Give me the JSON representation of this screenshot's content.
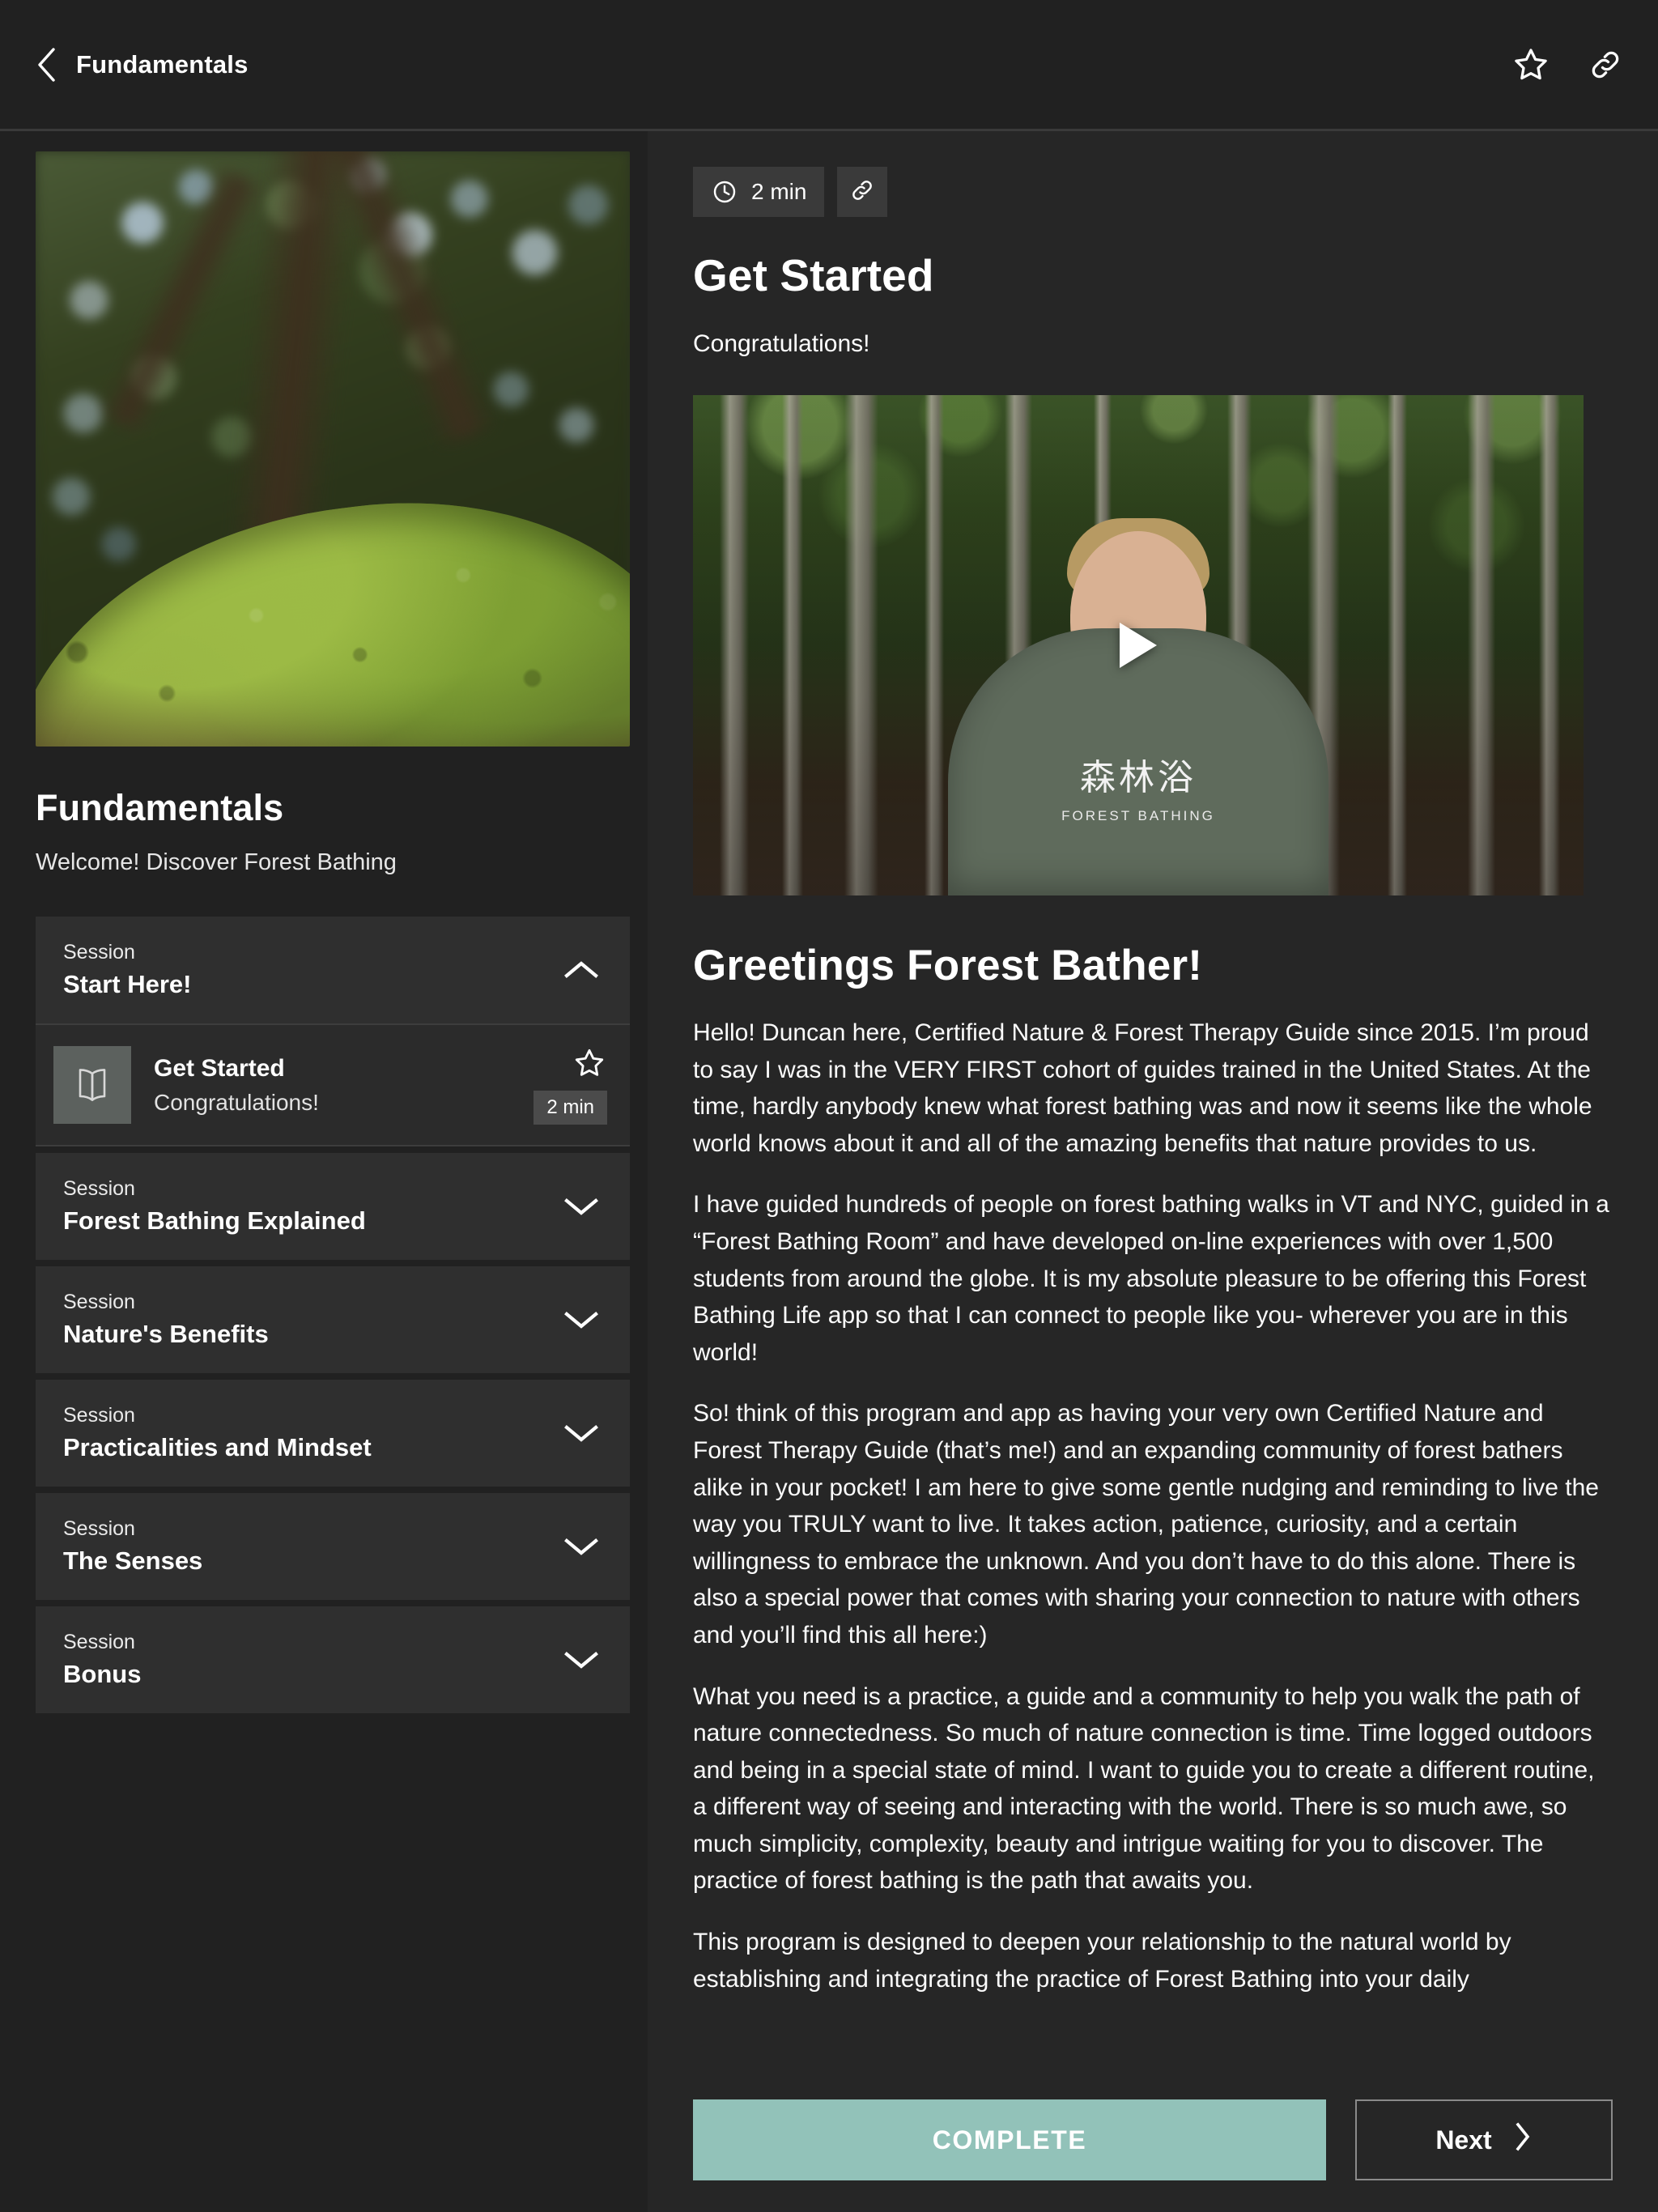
{
  "topbar": {
    "back_icon": "chevron-left-icon",
    "title": "Fundamentals",
    "favorite_icon": "star-outline-icon",
    "link_icon": "link-icon"
  },
  "sidebar": {
    "hero_image_alt": "mossy-tree-branch-photo",
    "course_title": "Fundamentals",
    "course_subtitle": "Welcome!  Discover Forest Bathing",
    "session_kicker": "Session",
    "sessions": [
      {
        "kicker": "Session",
        "name": "Start Here!",
        "expanded": true,
        "chevron": "chevron-up-icon"
      },
      {
        "kicker": "Session",
        "name": "Forest Bathing Explained",
        "expanded": false,
        "chevron": "chevron-down-icon"
      },
      {
        "kicker": "Session",
        "name": "Nature's Benefits",
        "expanded": false,
        "chevron": "chevron-down-icon"
      },
      {
        "kicker": "Session",
        "name": "Practicalities and Mindset",
        "expanded": false,
        "chevron": "chevron-down-icon"
      },
      {
        "kicker": "Session",
        "name": "The Senses",
        "expanded": false,
        "chevron": "chevron-down-icon"
      },
      {
        "kicker": "Session",
        "name": "Bonus",
        "expanded": false,
        "chevron": "chevron-down-icon"
      }
    ],
    "lesson": {
      "icon": "open-book-icon",
      "title": "Get Started",
      "subtitle": "Congratulations!",
      "duration": "2 min",
      "star_icon": "star-outline-icon"
    }
  },
  "main": {
    "duration_chip": {
      "icon": "clock-icon",
      "label": "2 min"
    },
    "link_chip_icon": "link-icon",
    "lesson_title": "Get Started",
    "lesson_tagline": "Congratulations!",
    "video": {
      "play_icon": "play-triangle-icon",
      "shirt_kanji": "森林浴",
      "shirt_subtext": "FOREST BATHING"
    },
    "article_heading": "Greetings Forest Bather!",
    "paragraphs": [
      "Hello! Duncan here, Certified Nature & Forest Therapy Guide since 2015. I’m proud to say I was in the VERY FIRST cohort of guides trained in the United States. At the time, hardly anybody knew what forest bathing was and now it seems like the whole world knows about it and all of the amazing benefits that nature provides to us.",
      "I have guided hundreds of people on forest bathing walks in VT and NYC, guided in a “Forest Bathing Room” and have developed on-line experiences with over 1,500 students from around the globe. It is my absolute pleasure to be offering this Forest Bathing Life app so that I can connect to people like you- wherever you are in this world!",
      "So! think of this program and app as having your very own Certified Nature and Forest Therapy Guide (that’s me!) and an expanding community of forest bathers alike in your pocket! I am here to give some gentle nudging and reminding to live the way you TRULY want to live. It takes action, patience, curiosity, and a certain willingness to embrace the unknown. And you don’t have to do this alone. There is also a special power that comes with sharing your connection to nature with others and you’ll find this all here:)",
      "What you need is a practice, a guide and a community to help you walk the path of nature connectedness. So much of nature connection is time. Time logged outdoors and being in a special state of mind. I want to guide you to create a different routine, a different way of seeing and interacting with the world. There is so much awe, so much simplicity, complexity, beauty and intrigue waiting for you to discover. The practice of forest bathing is the path that awaits you.",
      "This program is designed to deepen your relationship to the natural world by establishing and integrating the practice of Forest Bathing into your daily"
    ]
  },
  "actions": {
    "complete_label": "COMPLETE",
    "next_label": "Next",
    "next_icon": "chevron-right-icon",
    "complete_color": "#92c2b9"
  }
}
